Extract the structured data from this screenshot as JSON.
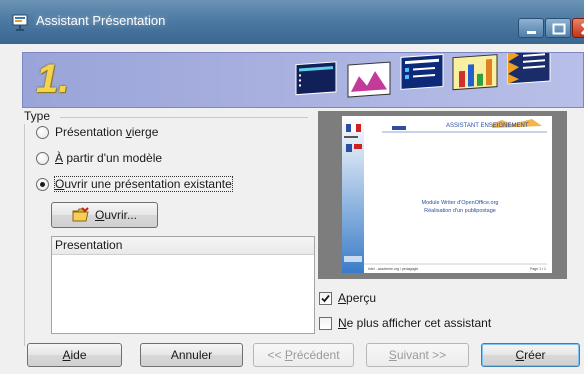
{
  "window": {
    "title": "Assistant Présentation",
    "icon": "presentation-app-icon"
  },
  "banner": {
    "step": "1."
  },
  "type_group": {
    "label": "Type",
    "options": [
      {
        "label_pre": "Présentation ",
        "label_u": "v",
        "label_post": "ierge",
        "checked": false
      },
      {
        "label_pre": "",
        "label_u": "À",
        "label_post": " partir d'un modèle",
        "checked": false
      },
      {
        "label_pre": "",
        "label_u": "O",
        "label_post": "uvrir une présentation existante",
        "checked": true
      }
    ]
  },
  "open_button": {
    "label_u": "O",
    "label_post": "uvrir..."
  },
  "presentation_list": {
    "header": "Presentation",
    "items": []
  },
  "preview": {
    "line1": "Module Writer d'OpenOffice.org",
    "line2": "Réalisation d'un publipostage",
    "header_text": "ASSISTANT ENSEIGNEMENT",
    "footer_left": "Intel - academie.org / pedagogie",
    "footer_right": "Page 1 / 1"
  },
  "checkboxes": {
    "apercu": {
      "label_u": "A",
      "label_post": "perçu",
      "checked": true
    },
    "ne_plus": {
      "label_u": "N",
      "label_post": "e plus afficher cet assistant",
      "checked": false
    }
  },
  "buttons": {
    "aide": {
      "label_u": "A",
      "label_post": "ide"
    },
    "annuler": {
      "label": "Annuler"
    },
    "precedent": {
      "label_pre": "<< ",
      "label_u": "P",
      "label_post": "récédent"
    },
    "suivant": {
      "label_u": "S",
      "label_post": "uivant >>"
    },
    "creer": {
      "label_u": "C",
      "label_post": "réer"
    }
  },
  "colors": {
    "titlebar": "#4d7aa3",
    "banner": "#a9b1e0",
    "step_number": "#f6d44a",
    "close_button": "#c2321a"
  }
}
